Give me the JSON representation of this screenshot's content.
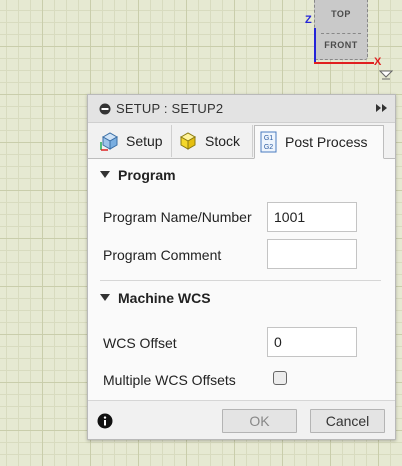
{
  "viewcube": {
    "top_label": "TOP",
    "front_label": "FRONT",
    "axis_z": "Z",
    "axis_x": "X",
    "colors": {
      "z_axis": "#2424d8",
      "x_axis": "#e02020"
    }
  },
  "dialog": {
    "title": "SETUP : SETUP2",
    "tabs": [
      {
        "label": "Setup",
        "icon": "setup-cube-icon",
        "active": false
      },
      {
        "label": "Stock",
        "icon": "stock-box-icon",
        "active": false
      },
      {
        "label": "Post Process",
        "icon": "g1-g2-icon",
        "icon_text": [
          "G1",
          "G2"
        ],
        "active": true
      }
    ],
    "sections": {
      "program": {
        "title": "Program",
        "name_label": "Program Name/Number",
        "name_value": "1001",
        "comment_label": "Program Comment",
        "comment_value": ""
      },
      "machine_wcs": {
        "title": "Machine WCS",
        "wcs_offset_label": "WCS Offset",
        "wcs_offset_value": "0",
        "multiple_label": "Multiple WCS Offsets",
        "multiple_checked": false
      }
    },
    "buttons": {
      "ok": "OK",
      "cancel": "Cancel"
    }
  }
}
